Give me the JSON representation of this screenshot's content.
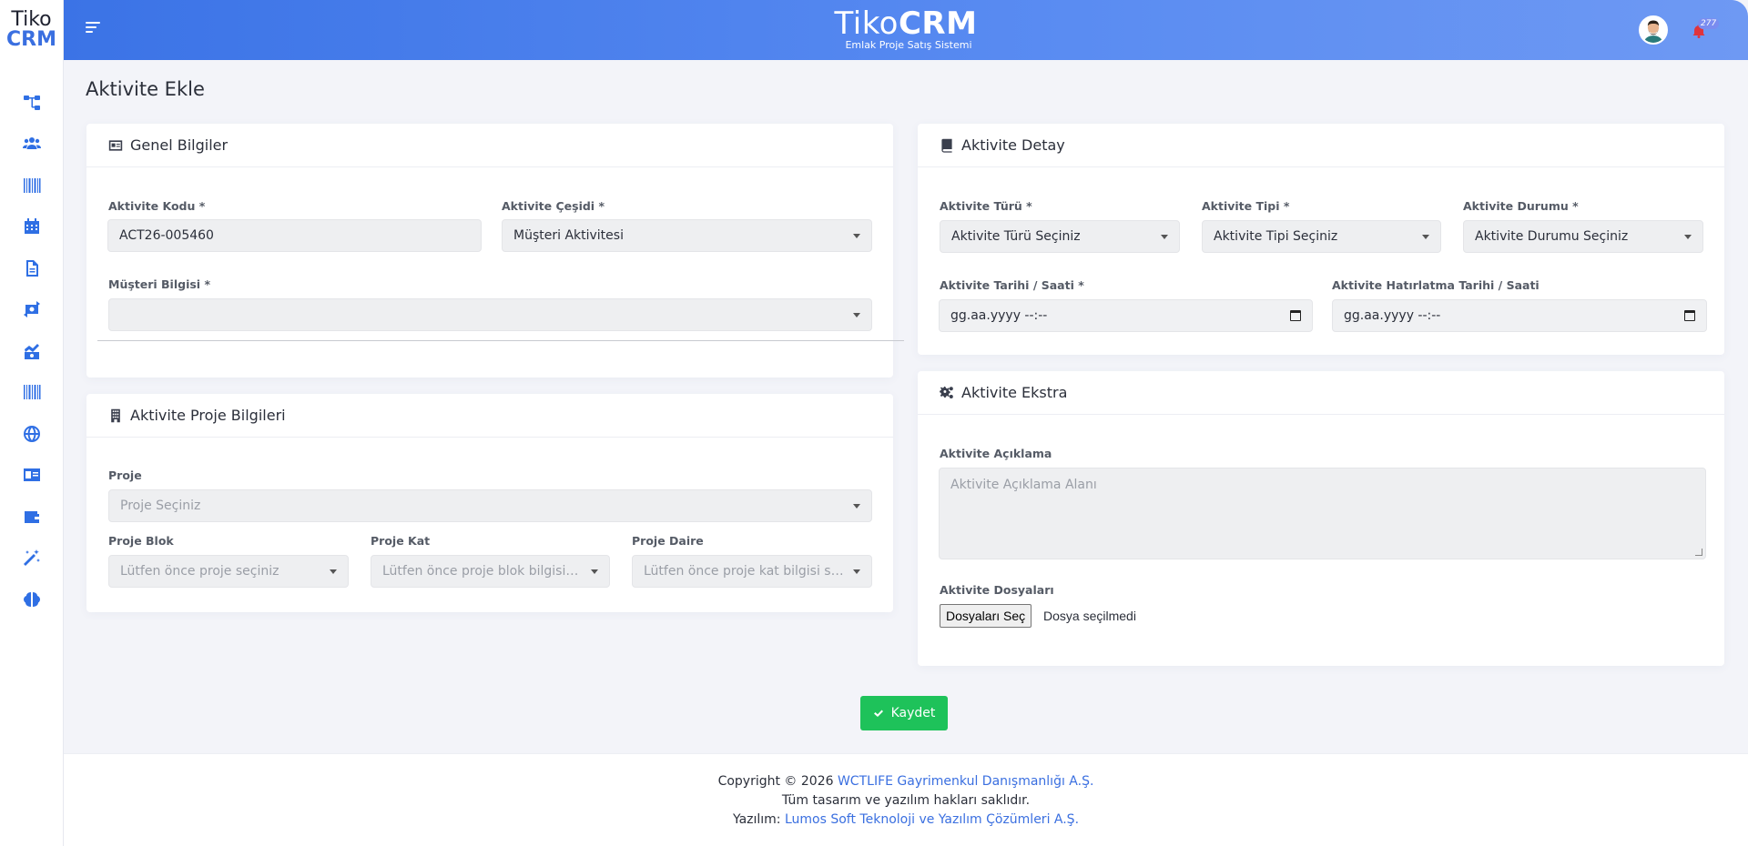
{
  "logo": {
    "line1": "Tiko",
    "line2": "CRM"
  },
  "sidebar": {
    "items": [
      {
        "icon": "sitemap-icon",
        "name": "sidebar-item-organization"
      },
      {
        "icon": "users-icon",
        "name": "sidebar-item-customers"
      },
      {
        "icon": "barcode-icon",
        "name": "sidebar-item-inventory"
      },
      {
        "icon": "calendar-icon",
        "name": "sidebar-item-calendar"
      },
      {
        "icon": "document-icon",
        "name": "sidebar-item-documents"
      },
      {
        "icon": "money-exchange-icon",
        "name": "sidebar-item-payments"
      },
      {
        "icon": "chart-money-icon",
        "name": "sidebar-item-sales"
      },
      {
        "icon": "barcode-icon",
        "name": "sidebar-item-stock"
      },
      {
        "icon": "globe-icon",
        "name": "sidebar-item-web"
      },
      {
        "icon": "id-card-icon",
        "name": "sidebar-item-contacts"
      },
      {
        "icon": "wallet-icon",
        "name": "sidebar-item-wallet"
      },
      {
        "icon": "magic-wand-icon",
        "name": "sidebar-item-tools"
      },
      {
        "icon": "brain-icon",
        "name": "sidebar-item-ai"
      }
    ]
  },
  "header": {
    "brand_light": "Tiko",
    "brand_bold": "CRM",
    "subtitle": "Emlak Proje Satış Sistemi",
    "notification_count": "277"
  },
  "page": {
    "title": "Aktivite Ekle"
  },
  "general": {
    "title": "Genel Bilgiler",
    "code_label": "Aktivite Kodu *",
    "code_value": "ACT26-005460",
    "kind_label": "Aktivite Çeşidi *",
    "kind_value": "Müşteri Aktivitesi",
    "customer_label": "Müşteri Bilgisi *",
    "customer_value": ""
  },
  "project": {
    "title": "Aktivite Proje Bilgileri",
    "project_label": "Proje",
    "project_placeholder": "Proje Seçiniz",
    "block_label": "Proje Blok",
    "block_placeholder": "Lütfen önce proje seçiniz",
    "floor_label": "Proje Kat",
    "floor_placeholder": "Lütfen önce proje blok bilgisi seçiniz",
    "unit_label": "Proje Daire",
    "unit_placeholder": "Lütfen önce proje kat bilgisi seçiniz"
  },
  "detail": {
    "title": "Aktivite Detay",
    "type_label": "Aktivite Türü *",
    "type_value": "Aktivite Türü Seçiniz",
    "subtype_label": "Aktivite Tipi *",
    "subtype_value": "Aktivite Tipi Seçiniz",
    "status_label": "Aktivite Durumu *",
    "status_value": "Aktivite Durumu Seçiniz",
    "date_label": "Aktivite Tarihi / Saati *",
    "date_value": "gg.aa.yyyy --:--",
    "reminder_label": "Aktivite Hatırlatma Tarihi / Saati",
    "reminder_value": "gg.aa.yyyy --:--"
  },
  "extra": {
    "title": "Aktivite Ekstra",
    "desc_label": "Aktivite Açıklama",
    "desc_placeholder": "Aktivite Açıklama Alanı",
    "files_label": "Aktivite Dosyaları",
    "files_button": "Dosyaları Seç",
    "files_status": "Dosya seçilmedi"
  },
  "actions": {
    "save_label": "Kaydet"
  },
  "footer": {
    "copyright_prefix": "Copyright © 2026",
    "company": "WCTLIFE Gayrimenkul Danışmanlığı A.Ş.",
    "rights": "Tüm tasarım ve yazılım hakları saklıdır.",
    "software_prefix": "Yazılım:",
    "software_company": "Lumos Soft Teknoloji ve Yazılım Çözümleri A.Ş."
  },
  "colors": {
    "accent": "#3b73e6",
    "save": "#1ec25a",
    "bell": "#e0343c"
  }
}
